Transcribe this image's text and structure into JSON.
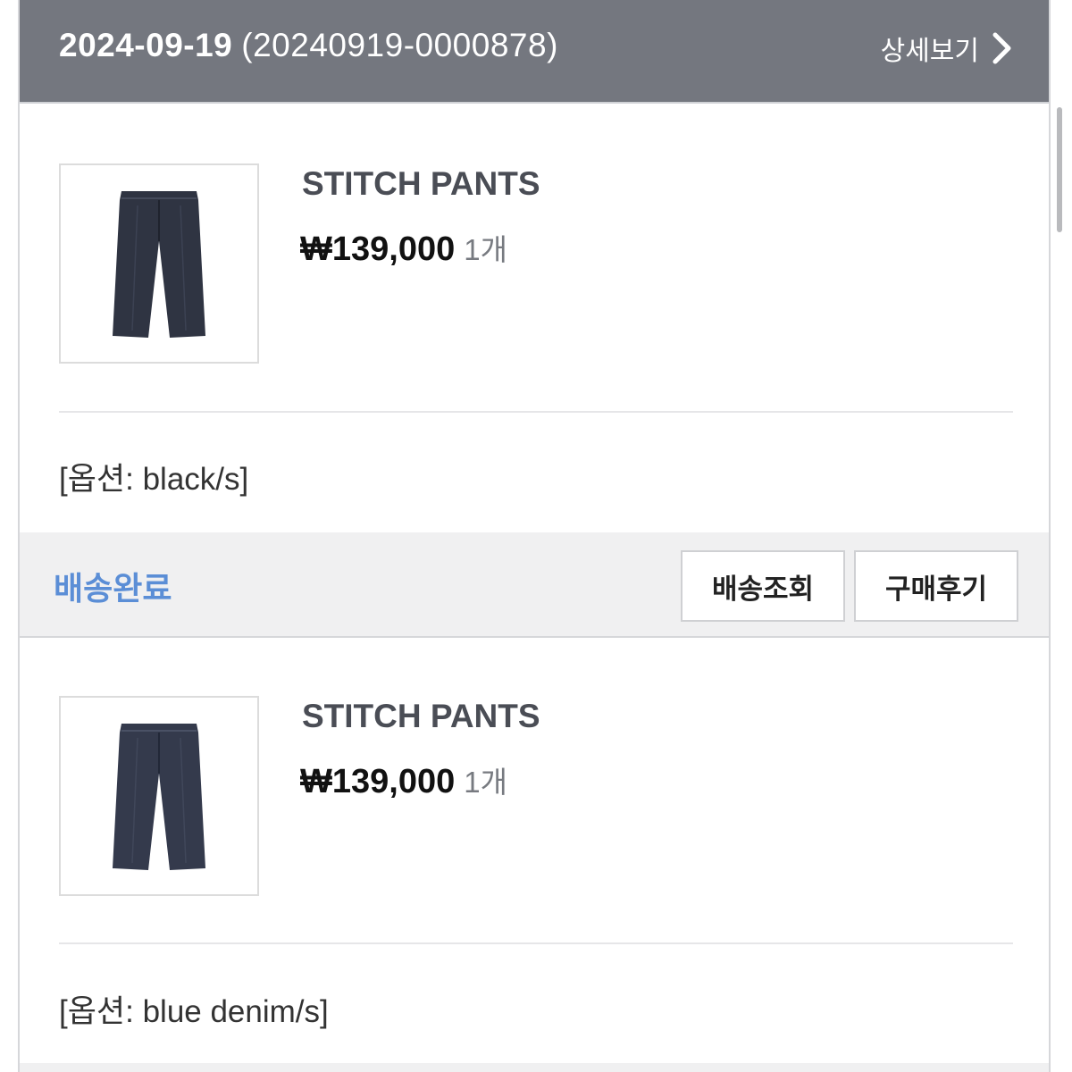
{
  "order": {
    "date": "2024-09-19",
    "number": "(20240919-0000878)",
    "detail_label": "상세보기"
  },
  "items": [
    {
      "name": "STITCH PANTS",
      "price": "₩139,000",
      "qty": "1개",
      "option": "[옵션: black/s]"
    },
    {
      "name": "STITCH PANTS",
      "price": "₩139,000",
      "qty": "1개",
      "option": "[옵션: blue denim/s]"
    }
  ],
  "status": {
    "label": "배송완료",
    "track_button": "배송조회",
    "review_button": "구매후기"
  },
  "colors": {
    "header_bg": "#74777f",
    "status_text": "#5b8ed6",
    "pants": "#2f3442"
  },
  "icons": {
    "detail": "chevron-right-icon",
    "product_image": "pants-image"
  }
}
